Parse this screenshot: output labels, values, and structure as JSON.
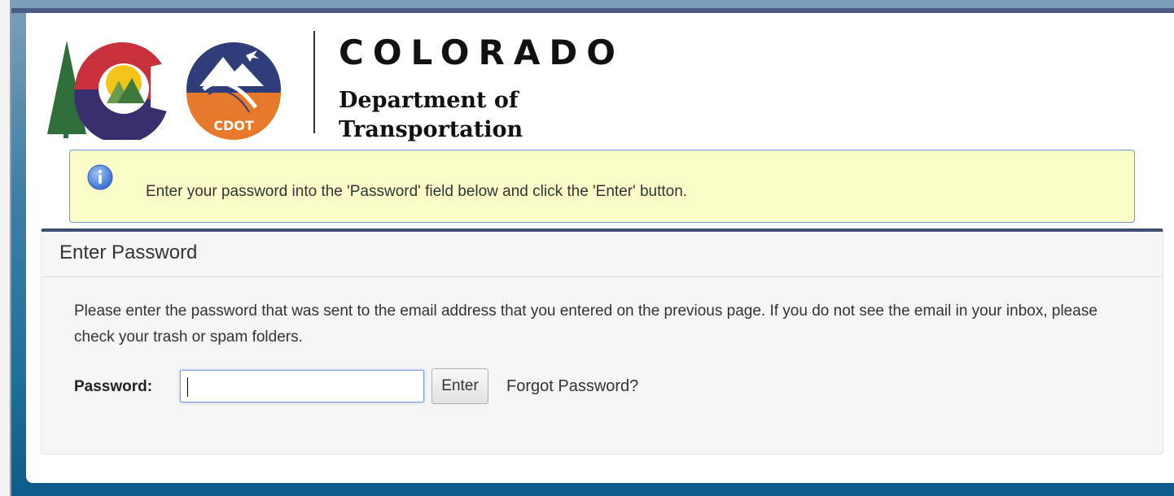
{
  "header": {
    "title": "COLORADO",
    "subtitle_line1": "Department of",
    "subtitle_line2": "Transportation",
    "badge_text": "CDOT"
  },
  "alert": {
    "icon": "info-icon",
    "message": "Enter your password into the 'Password' field below and click the 'Enter' button."
  },
  "panel": {
    "heading": "Enter Password",
    "description": "Please enter the password that was sent to the email address that you entered on the previous page. If you do not see the email in your inbox, please check your trash or spam folders.",
    "password_label": "Password:",
    "password_value": "",
    "enter_label": "Enter",
    "forgot_label": "Forgot Password?"
  },
  "colors": {
    "accent": "#3e4f77",
    "alert_background": "#fbfdc9",
    "alert_border": "#6d97d7",
    "cdot_orange": "#e67a2a",
    "cdot_navy": "#2f3e7a"
  }
}
